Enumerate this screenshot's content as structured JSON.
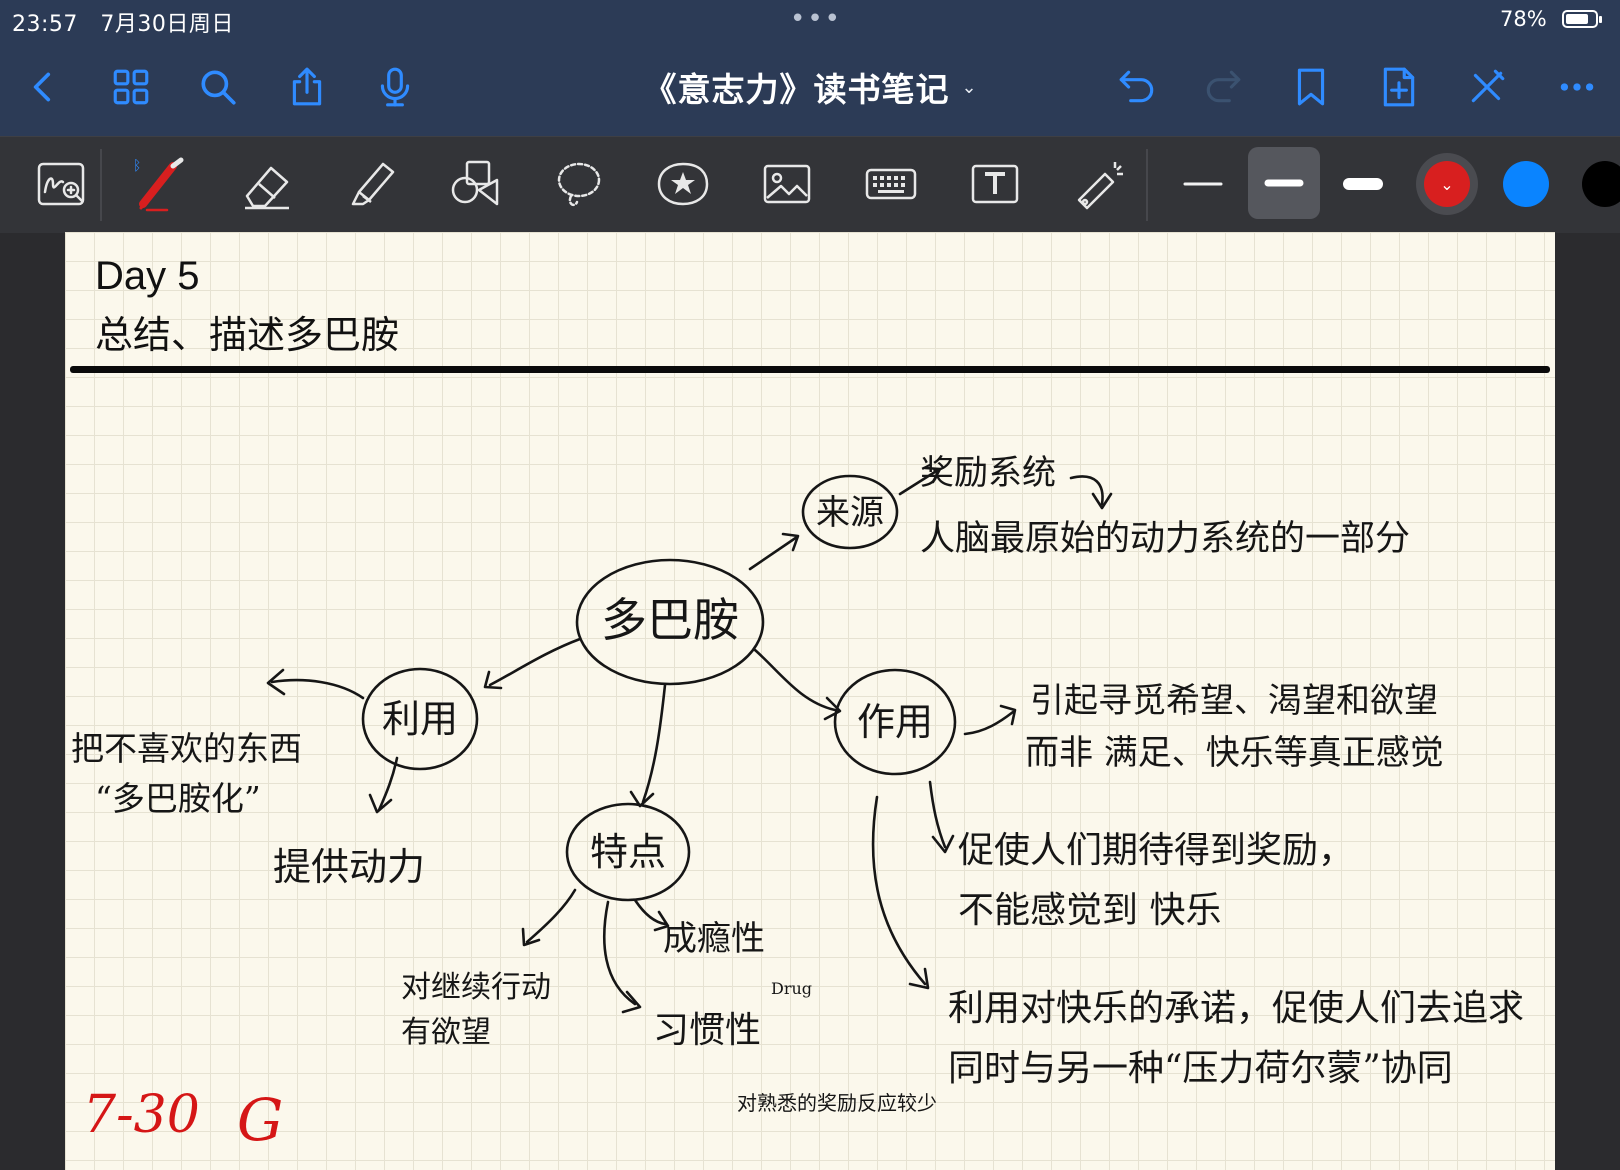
{
  "status": {
    "time": "23:57",
    "date": "7月30日周日",
    "battery": "78%",
    "battery_fraction": 0.78
  },
  "nav": {
    "title": "《意志力》读书笔记"
  },
  "toolbar": {
    "tools": [
      "handwriting-search-icon",
      "pen-icon",
      "eraser-icon",
      "highlighter-icon",
      "shapes-icon",
      "lasso-icon",
      "sticker-icon",
      "image-icon",
      "keyboard-icon",
      "textbox-icon",
      "laser-pointer-icon"
    ],
    "active_color": "#d81f1f",
    "swatch_blue": "#0a84ff",
    "swatch_black": "#000000"
  },
  "note": {
    "day": "Day 5",
    "subtitle": "总结、描述多巴胺",
    "center": "多巴胺",
    "source_node": "来源",
    "source_text_1": "奖励系统",
    "source_text_2": "人脑最原始的动力系统的一部分",
    "use_node": "利用",
    "use_text_1": "把不喜欢的东西",
    "use_text_2": "“多巴胺化”",
    "use_text_3": "提供动力",
    "effect_node": "作用",
    "effect_text_1": "引起寻觅希望、渴望和欲望",
    "effect_text_2": "而非 满足、快乐等真正感觉",
    "effect_text_3": "促使人们期待得到奖励，",
    "effect_text_4": "不能感觉到 快乐",
    "effect_text_5": "利用对快乐的承诺，促使人们去追求",
    "effect_text_6": "同时与另一种“压力荷尔蒙”协同",
    "feature_node": "特点",
    "feature_text_1": "对继续行动",
    "feature_text_2": "有欲望",
    "feature_text_3": "成瘾性",
    "feature_text_4": "Drug",
    "feature_text_5": "习惯性",
    "feature_text_6": "对熟悉的奖励反应较少",
    "date_mark": "7-30",
    "sign_mark": "G"
  }
}
